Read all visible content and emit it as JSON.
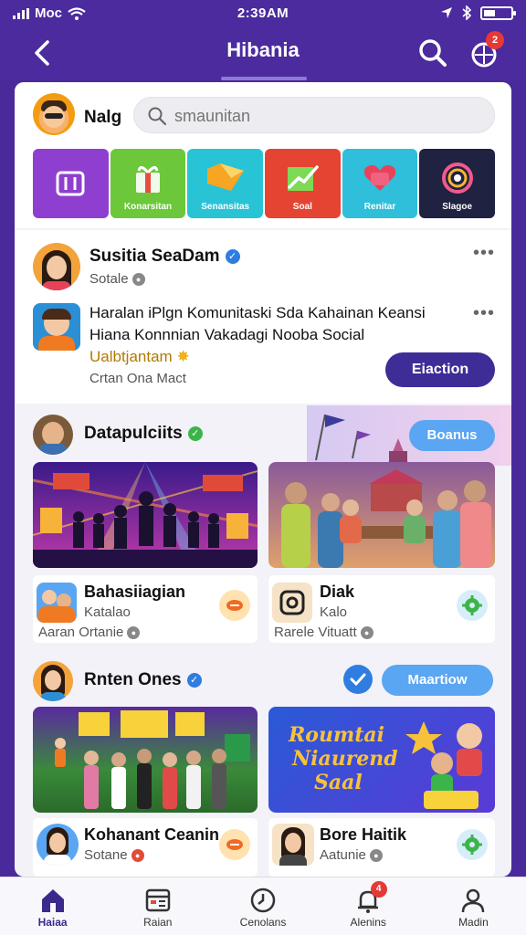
{
  "status_bar": {
    "carrier": "Moc",
    "time": "2:39AM"
  },
  "app_bar": {
    "title": "Hibania",
    "notification_count": "2"
  },
  "profile": {
    "name": "Nalg"
  },
  "search": {
    "placeholder": "smaunitan"
  },
  "categories": [
    {
      "label": "",
      "color": "#8e3fd0"
    },
    {
      "label": "Konarsitan",
      "color": "#6cc83a"
    },
    {
      "label": "Senansitas",
      "color": "#29c3d6"
    },
    {
      "label": "Soal",
      "color": "#e54432"
    },
    {
      "label": "Renitar",
      "color": "#2fbfda"
    },
    {
      "label": "Slagoe",
      "color": "#1f2240"
    }
  ],
  "post_author": {
    "name": "Susitia SeaDam",
    "subtitle": "Sotale"
  },
  "post": {
    "line1": "Haralan iPlgn Komunitaski Sda Kahainan Keansi",
    "line2": "Hiana Konnnian Vakadagi Nooba Social",
    "line3": "Ualbtjantam",
    "meta": "Crtan Ona Mact",
    "button": "Eiaction"
  },
  "section1": {
    "title": "Datapulciits",
    "button": "Boanus",
    "cards": [
      {
        "title": "Bahasiiagian",
        "subtitle": "Katalao",
        "meta": "Aaran Ortanie"
      },
      {
        "title": "Diak",
        "subtitle": "Kalo",
        "meta": "Rarele Vituatt"
      }
    ]
  },
  "section2": {
    "title": "Rnten Ones",
    "button": "Maartiow",
    "banner_text": [
      "Roumtai",
      "Niaurend",
      "Saal"
    ],
    "cards": [
      {
        "title": "Kohanant Ceanin",
        "subtitle": "Sotane"
      },
      {
        "title": "Bore Haitik",
        "subtitle": "Aatunie"
      }
    ]
  },
  "bottom_nav": [
    {
      "label": "Haiaa",
      "icon": "home-icon"
    },
    {
      "label": "Raian",
      "icon": "calendar-icon"
    },
    {
      "label": "Cenolans",
      "icon": "clock-icon"
    },
    {
      "label": "Alenins",
      "icon": "bell-icon",
      "badge": "4"
    },
    {
      "label": "Madin",
      "icon": "person-icon"
    }
  ]
}
